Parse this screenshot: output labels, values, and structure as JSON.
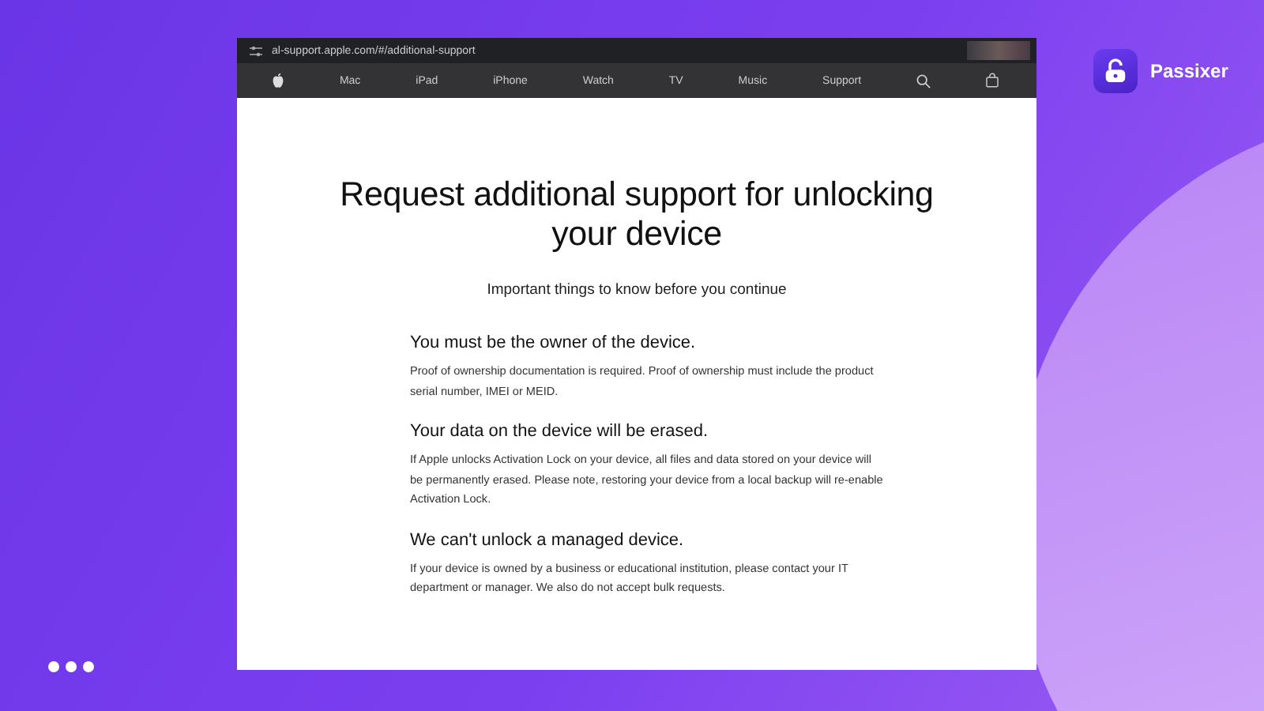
{
  "brand": {
    "name": "Passixer"
  },
  "browser": {
    "url": "al-support.apple.com/#/additional-support",
    "nav_items": [
      "Mac",
      "iPad",
      "iPhone",
      "Watch",
      "TV",
      "Music",
      "Support"
    ]
  },
  "page": {
    "title": "Request additional support for unlocking your device",
    "subtitle": "Important things to know before you continue",
    "sections": [
      {
        "heading": "You must be the owner of the device.",
        "body": "Proof of ownership documentation is required. Proof of ownership must include the product serial number, IMEI or MEID."
      },
      {
        "heading": "Your data on the device will be erased.",
        "body": "If Apple unlocks Activation Lock on your device, all files and data stored on your device will be permanently erased. Please note, restoring your device from a local backup will re-enable Activation Lock."
      },
      {
        "heading": "We can't unlock a managed device.",
        "body": "If your device is owned by a business or educational institution, please contact your IT department or manager. We also do not accept bulk requests."
      }
    ]
  }
}
